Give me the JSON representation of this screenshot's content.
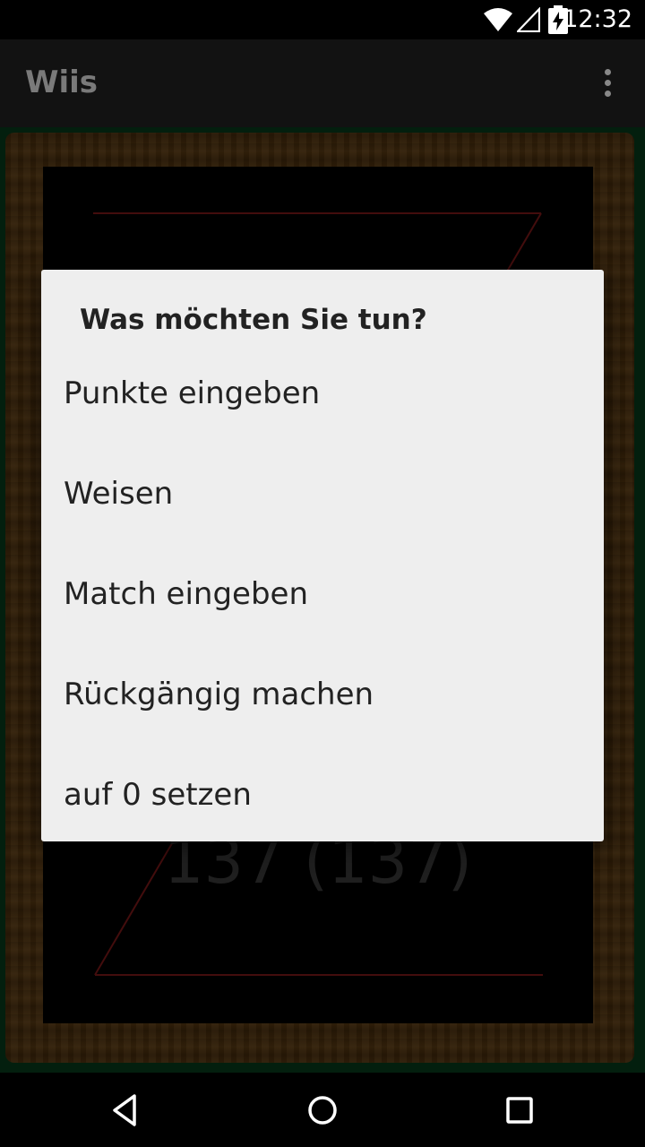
{
  "status_bar": {
    "time": "12:32",
    "icons": [
      "wifi-icon",
      "signal-icon",
      "battery-charging-icon"
    ]
  },
  "app_bar": {
    "title": "Wiis",
    "menu_icon": "overflow-menu-icon"
  },
  "board": {
    "score_text": "137 (137)"
  },
  "dialog": {
    "title": "Was möchten Sie tun?",
    "items": [
      {
        "label": "Punkte eingeben"
      },
      {
        "label": "Weisen"
      },
      {
        "label": "Match eingeben"
      },
      {
        "label": "Rückgängig machen"
      },
      {
        "label": "auf 0 setzen"
      }
    ]
  },
  "nav_bar": {
    "icons": [
      "back-icon",
      "home-icon",
      "recents-icon"
    ]
  },
  "colors": {
    "dialog_background": "#eeeeee",
    "board_line": "#7a1818",
    "felt_green": "#063a1a",
    "wood_frame": "#5a3a12"
  }
}
